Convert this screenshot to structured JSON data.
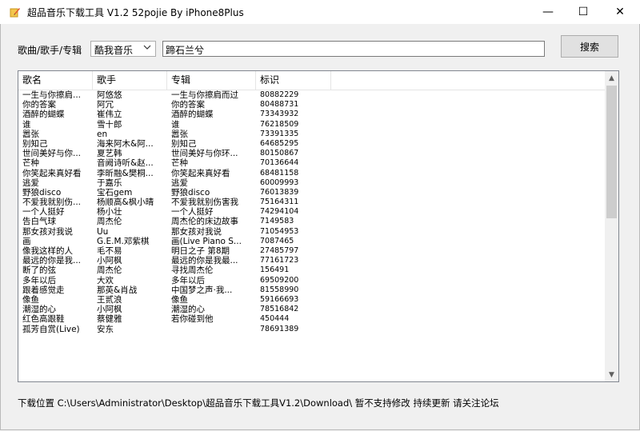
{
  "window": {
    "title": "超品音乐下载工具 V1.2 52pojie By iPhone8Plus",
    "minimize_glyph": "—",
    "maximize_glyph": "☐",
    "close_glyph": "✕",
    "icon": "app-pencil-icon"
  },
  "search": {
    "label": "歌曲/歌手/专辑",
    "source_value": "酷我音乐",
    "query": "蹄石兰兮",
    "button_label": "搜索"
  },
  "table": {
    "columns": [
      "歌名",
      "歌手",
      "专辑",
      "标识"
    ],
    "rows": [
      [
        "一生与你擦肩...",
        "阿悠悠",
        "一生与你擦肩而过",
        "80882229"
      ],
      [
        "你的答案",
        "阿冗",
        "你的答案",
        "80488731"
      ],
      [
        "酒醉的蝴蝶",
        "崔伟立",
        "酒醉的蝴蝶",
        "73343932"
      ],
      [
        "谁",
        "雪十郎",
        "谁",
        "76218509"
      ],
      [
        "嚣张",
        "en",
        "嚣张",
        "73391335"
      ],
      [
        "别知己",
        "海来阿木&阿...",
        "别知己",
        "64685295"
      ],
      [
        "世间美好与你...",
        "夏艺韩",
        "世间美好与你环...",
        "80150867"
      ],
      [
        "芒种",
        "音阙诗听&赵...",
        "芒种",
        "70136644"
      ],
      [
        "你笑起来真好看",
        "李昕融&樊桐...",
        "你笑起来真好看",
        "68481158"
      ],
      [
        "逃爱",
        "于嘉乐",
        "逃爱",
        "60009993"
      ],
      [
        "野狼disco",
        "宝石gem",
        "野狼disco",
        "76013839"
      ],
      [
        "不爱我就别伤...",
        "杨顺高&枫小晴",
        "不爱我就别伤害我",
        "75164311"
      ],
      [
        "一个人挺好",
        "杨小壮",
        "一个人挺好",
        "74294104"
      ],
      [
        "告白气球",
        "周杰伦",
        "周杰伦的床边故事",
        "7149583"
      ],
      [
        "那女孩对我说",
        "Uu",
        "那女孩对我说",
        "71054953"
      ],
      [
        "画",
        "G.E.M.邓紫棋",
        "画(Live Piano S...",
        "7087465"
      ],
      [
        "像我这样的人",
        "毛不易",
        "明日之子 第8期",
        "27485797"
      ],
      [
        "最远的你是我...",
        "小阿枫",
        "最远的你是我最...",
        "77161723"
      ],
      [
        "断了的弦",
        "周杰伦",
        "寻找周杰伦",
        "156491"
      ],
      [
        "多年以后",
        "大欢",
        "多年以后",
        "69509200"
      ],
      [
        "跟着感觉走",
        "那英&肖战",
        "中国梦之声·我...",
        "81558990"
      ],
      [
        "像鱼",
        "王贰浪",
        "像鱼",
        "59166693"
      ],
      [
        "潮湿的心",
        "小阿枫",
        "潮湿的心",
        "78516842"
      ],
      [
        "红色高跟鞋",
        "蔡健雅",
        "若你碰到他",
        "450444"
      ],
      [
        "孤芳自赏(Live)",
        "安东",
        "",
        "78691389"
      ]
    ]
  },
  "scrollbar": {
    "up_glyph": "▲",
    "down_glyph": "▼",
    "thumb_fraction": 0.47
  },
  "status": {
    "text": "下载位置 C:\\Users\\Administrator\\Desktop\\超品音乐下载工具V1.2\\Download\\ 暂不支持修改 持续更新 请关注论坛"
  }
}
